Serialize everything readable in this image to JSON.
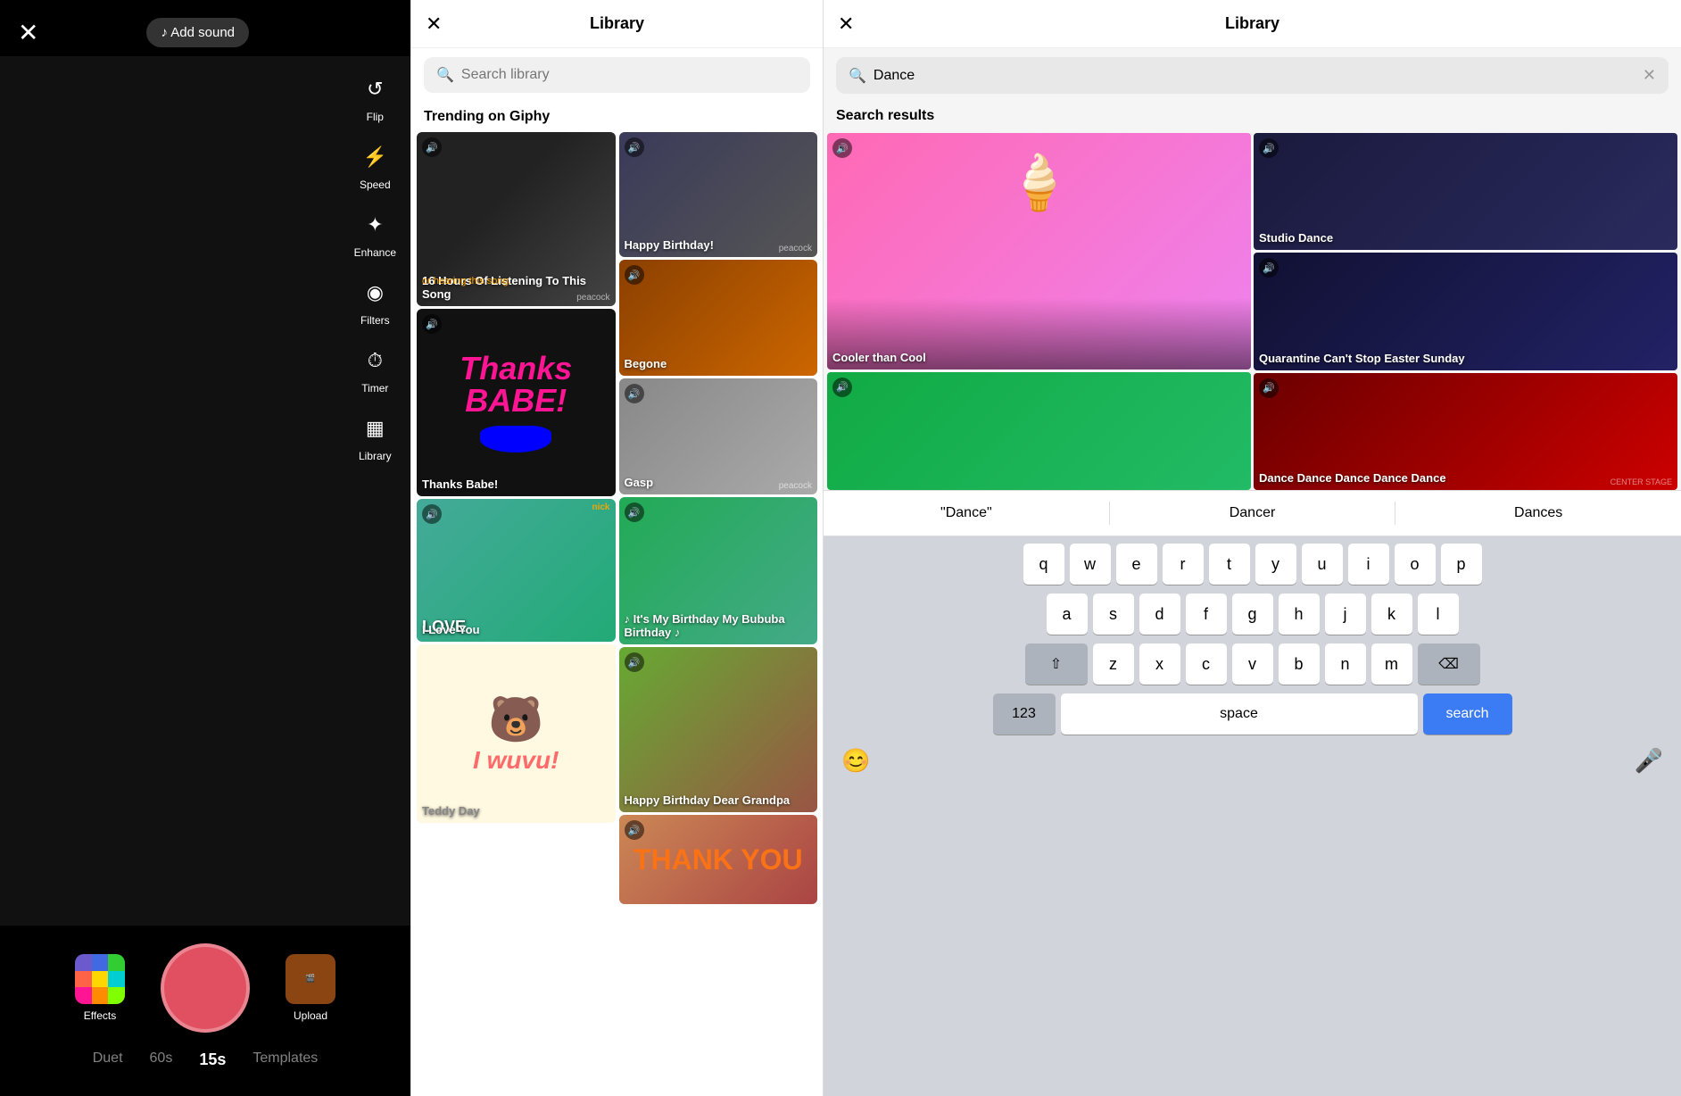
{
  "left": {
    "close_label": "✕",
    "add_sound_label": "♪ Add sound",
    "toolbar": [
      {
        "id": "flip",
        "icon": "↺",
        "label": "Flip"
      },
      {
        "id": "speed",
        "icon": "⚡",
        "label": "Speed"
      },
      {
        "id": "enhance",
        "icon": "✦",
        "label": "Enhance"
      },
      {
        "id": "filters",
        "icon": "◉",
        "label": "Filters"
      },
      {
        "id": "timer",
        "icon": "⏱",
        "label": "Timer"
      },
      {
        "id": "library",
        "icon": "▦",
        "label": "Library"
      }
    ],
    "bottom": {
      "effects_label": "Effects",
      "upload_label": "Upload",
      "duration_tabs": [
        {
          "id": "duet",
          "label": "Duet",
          "active": false
        },
        {
          "id": "60s",
          "label": "60s",
          "active": false
        },
        {
          "id": "15s",
          "label": "15s",
          "active": true
        },
        {
          "id": "templates",
          "label": "Templates",
          "active": false
        }
      ]
    }
  },
  "middle": {
    "title": "Library",
    "close_label": "✕",
    "search_placeholder": "Search library",
    "trending_title": "Trending on Giphy",
    "gifs": [
      {
        "id": "jojo",
        "label": "16 Hours Of Listening To This Song",
        "label2": "or hearing this song.",
        "label2_color": "orange",
        "col": 0,
        "size": "tall"
      },
      {
        "id": "birthday",
        "label": "Happy Birthday!",
        "col": 1,
        "size": "medium"
      },
      {
        "id": "thanks",
        "label": "Thanks Babe!",
        "col": 0,
        "size": "tall"
      },
      {
        "id": "begone",
        "label": "Begone",
        "col": 1,
        "size": "medium"
      },
      {
        "id": "gasp",
        "label": "Gasp",
        "col": 1,
        "size": "medium"
      },
      {
        "id": "patrick",
        "label": "I Love You",
        "col": 0,
        "size": "tall"
      },
      {
        "id": "southpark",
        "label": "♪ It's My Birthday My Bububa Birthday ♪",
        "col": 1,
        "size": "tall"
      },
      {
        "id": "teddy",
        "label": "Teddy Day",
        "col": 0,
        "size": "tall"
      },
      {
        "id": "bday-grandpa",
        "label": "Happy Birthday Dear Grandpa",
        "col": 1,
        "size": "tall"
      },
      {
        "id": "thankyou",
        "label": "THANK YOU",
        "col": 1,
        "size": "medium"
      }
    ]
  },
  "right": {
    "title": "Library",
    "close_label": "✕",
    "search_value": "Dance",
    "clear_label": "✕",
    "results_title": "Search results",
    "results": [
      {
        "id": "cooler",
        "label": "Cooler than Cool",
        "col": 0
      },
      {
        "id": "studio",
        "label": "Studio Dance",
        "col": 1
      },
      {
        "id": "quarantine",
        "label": "Quarantine Can't Stop Easter Sunday",
        "col": 1
      },
      {
        "id": "kids-dance",
        "label": "",
        "col": 0
      },
      {
        "id": "dance-dance",
        "label": "Dance Dance Dance Dance Dance",
        "col": 1
      }
    ],
    "suggestions": [
      {
        "id": "dance-quoted",
        "label": "\"Dance\""
      },
      {
        "id": "dancer",
        "label": "Dancer"
      },
      {
        "id": "dances",
        "label": "Dances"
      }
    ],
    "keyboard": {
      "rows": [
        [
          "q",
          "w",
          "e",
          "r",
          "t",
          "y",
          "u",
          "i",
          "o",
          "p"
        ],
        [
          "a",
          "s",
          "d",
          "f",
          "g",
          "h",
          "j",
          "k",
          "l"
        ],
        [
          "⇧",
          "z",
          "x",
          "c",
          "v",
          "b",
          "n",
          "m",
          "⌫"
        ],
        [
          "123",
          "space",
          "search"
        ]
      ]
    },
    "emoji_label": "😊",
    "mic_label": "🎤"
  }
}
